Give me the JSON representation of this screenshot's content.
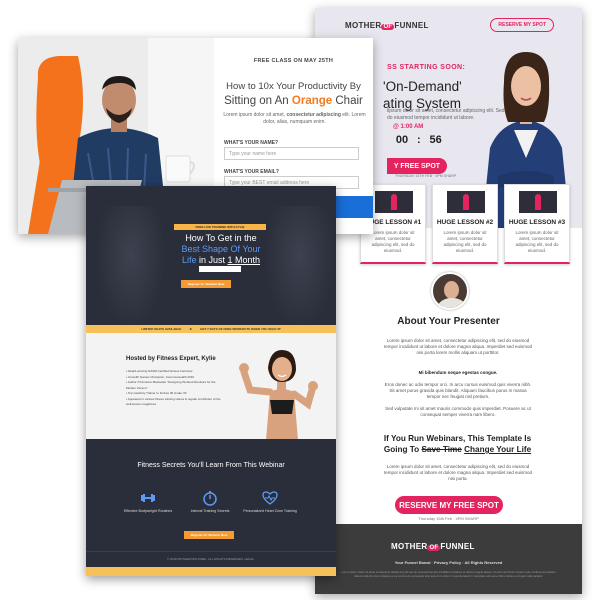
{
  "mother_funnel": {
    "logo_left": "MOTHER",
    "logo_mid": "OF",
    "logo_right": "FUNNEL",
    "nav_button": "RESERVE MY SPOT",
    "eyebrow": "SS STARTING SOON:",
    "headline_1": "'On-Demand'",
    "headline_2": "ating System",
    "sub": "lipsum dolor sit amet, consectetur adipiscing elit. Sed do eiusmod tempor incididunt ut labore.",
    "time": "@ 1:00 AM",
    "countdown_1": "00",
    "countdown_2": "56",
    "countdown_label": "SECONDS",
    "cta": "Y FREE SPOT",
    "cta_sub": "THURSDAY 15TH FEB · 4PM SHARP",
    "lessons": [
      {
        "title": "HUGE LESSON #1",
        "desc": "Lorem ipsum dolor sit amet, consectetur adipiscing elit, sed do eiusmod."
      },
      {
        "title": "HUGE LESSON #2",
        "desc": "Lorem ipsum dolor sit amet, consectetur adipiscing elit, sed do eiusmod."
      },
      {
        "title": "HUGE LESSON #3",
        "desc": "Lorem ipsum dolor sit amet, consectetur adipiscing elit, sed do eiusmod."
      }
    ],
    "presenter_title": "About Your Presenter",
    "p1": "Lorem ipsum dolor sit amet, consectetur adipiscing elit, sed do eiusmod tempor incididunt ut labore et dolore magna aliqua. Imperdiet sed euismod nisi porta lorem mollis aliquam ut porttitor.",
    "p2": "Mi bibendum neque egestas congue.",
    "p3": "Eros donec ac odio tempor orci. In arcu cursus euismod quis viverra nibh. Sit amet purus gravida quis blandit. Aliquam faucibus purus in massa tempor nec feugiat nisl pretium.",
    "p4": "Sed vulputate mi sit amet mauris commodo quis imperdiet. Posuere ac ut consequat semper viverra nam libero.",
    "webinar_1": "If You Run Webinars, This Template Is",
    "webinar_2": "Going To",
    "webinar_strike": "Save Time",
    "webinar_u": "Change Your Life",
    "p5": "Lorem ipsum dolor sit amet, consectetur adipiscing elit, sed do eiusmod tempor incididunt ut labore et dolore magna aliqua. Imperdiet sed euismod nisi porta.",
    "button2": "RESERVE MY FREE SPOT",
    "button2_sub": "Thursday 15th Feb · 4PM SHARP",
    "footer_links": "Your Funnel Brand  ·  Privacy Policy  ·  All Rights Reserved",
    "footer_disclaimer": "Lorem ipsum dolor sit amet consectetur adipiscing elit sed do eiusmod tempor incididunt ut labore et dolore magna aliqua. Ut enim ad minim veniam quis nostrud exercitation ullamco laboris nisi ut aliquip ex ea commodo consequat duis aute irure dolor in reprehenderit in voluptate velit esse cillum dolore eu fugiat nulla pariatur."
  },
  "orange_chair": {
    "eyebrow": "FREE CLASS ON MAY 25TH",
    "headline_1": "How to 10x Your Productivity By",
    "headline_2a": "Sitting on An",
    "headline_2b": "Orange",
    "headline_2c": "Chair",
    "sub_a": "Lorem ipsum dolor sit amet,",
    "sub_b": "consectetur adipiscing",
    "sub_c": "elit. Lorem dolor, alias, numquam enim.",
    "label_name": "WHAT'S YOUR NAME?",
    "placeholder_name": "Type your name here",
    "label_email": "WHAT'S YOUR EMAIL?",
    "placeholder_email": "Type your BEST email address here"
  },
  "fitness": {
    "pill": "FREE LIVE TRAINING WITH KYLIE",
    "title_1": "How To Get in the",
    "title_2": "Best Shape Of Your",
    "title_3a": "Life",
    "title_3b": "in Just",
    "title_3c": "1 Month",
    "button": "Register for Webinar Now",
    "bar_a": "LIMITED SEATS AVAILABLE",
    "bar_b": "GET 7 DAYS OF FREE WORKOUTS WHEN YOU SIGN UP",
    "host": "Hosted by Fitness Expert, Kylie",
    "bullets": [
      "Award-winning NASM Certified Fitness Instructor",
      "CrossFit Games Champion, Commonwealth 2016",
      "Author Of Amazon Bestseller \"Designing Workout Routines for the Modern Person\"",
      "Top Celebrity Trainer to Forbes 30 Under 30",
      "Appeared in various fitness training videos & regular contributor of the well-known magazines"
    ],
    "secrets_title": "Fitness Secrets You'll Learn From This Webinar",
    "features": [
      "Effective Bodyweight Routines",
      "Interval Training Secrets",
      "Personalized Heart Zone Training"
    ],
    "button2": "Register for Webinar Now",
    "footer": "© 2018 MOTHEROFFUNNEL. ALL RIGHTS RESERVED. LEGAL."
  }
}
